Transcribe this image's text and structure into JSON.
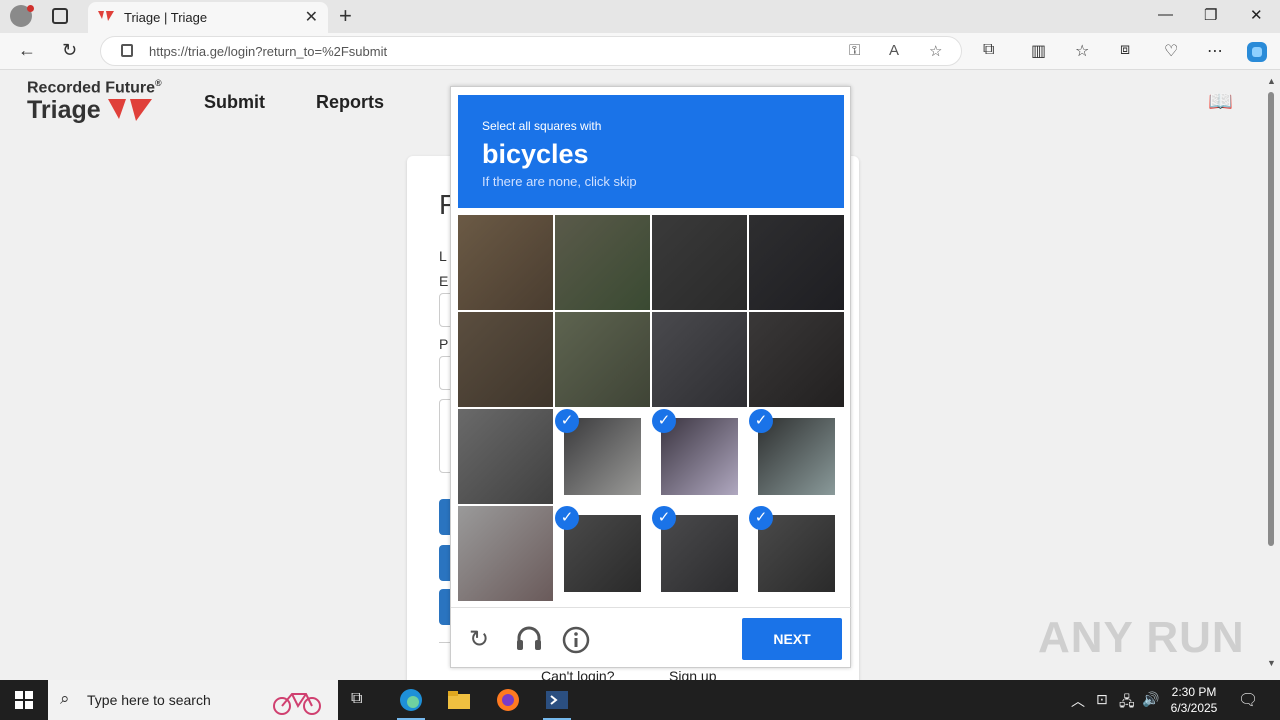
{
  "browser": {
    "tab_title": "Triage | Triage",
    "url": "https://tria.ge/login?return_to=%2Fsubmit"
  },
  "site": {
    "brand_top": "Recorded Future",
    "brand_reg": "®",
    "brand_name": "Triage",
    "nav": [
      "Submit",
      "Reports"
    ],
    "card": {
      "heading_frag": "F",
      "label1_frag": "L",
      "label2_frag": "E",
      "label3_frag": "P",
      "cant_login": "Can't login?",
      "sign_up": "Sign up"
    }
  },
  "captcha": {
    "instruction": "Select all squares with",
    "target": "bicycles",
    "hint": "If there are none, click skip",
    "next_label": "NEXT",
    "check_glyph": "✓",
    "tiles": [
      {
        "selected": false
      },
      {
        "selected": false
      },
      {
        "selected": false
      },
      {
        "selected": false
      },
      {
        "selected": false
      },
      {
        "selected": false
      },
      {
        "selected": false
      },
      {
        "selected": false
      },
      {
        "selected": false
      },
      {
        "selected": true
      },
      {
        "selected": true
      },
      {
        "selected": true
      },
      {
        "selected": false
      },
      {
        "selected": true
      },
      {
        "selected": true
      },
      {
        "selected": true
      }
    ],
    "colors": {
      "accent": "#1a73e8"
    }
  },
  "watermark": "ANY RUN",
  "taskbar": {
    "search_placeholder": "Type here to search",
    "time": "2:30 PM",
    "date": "6/3/2025"
  }
}
